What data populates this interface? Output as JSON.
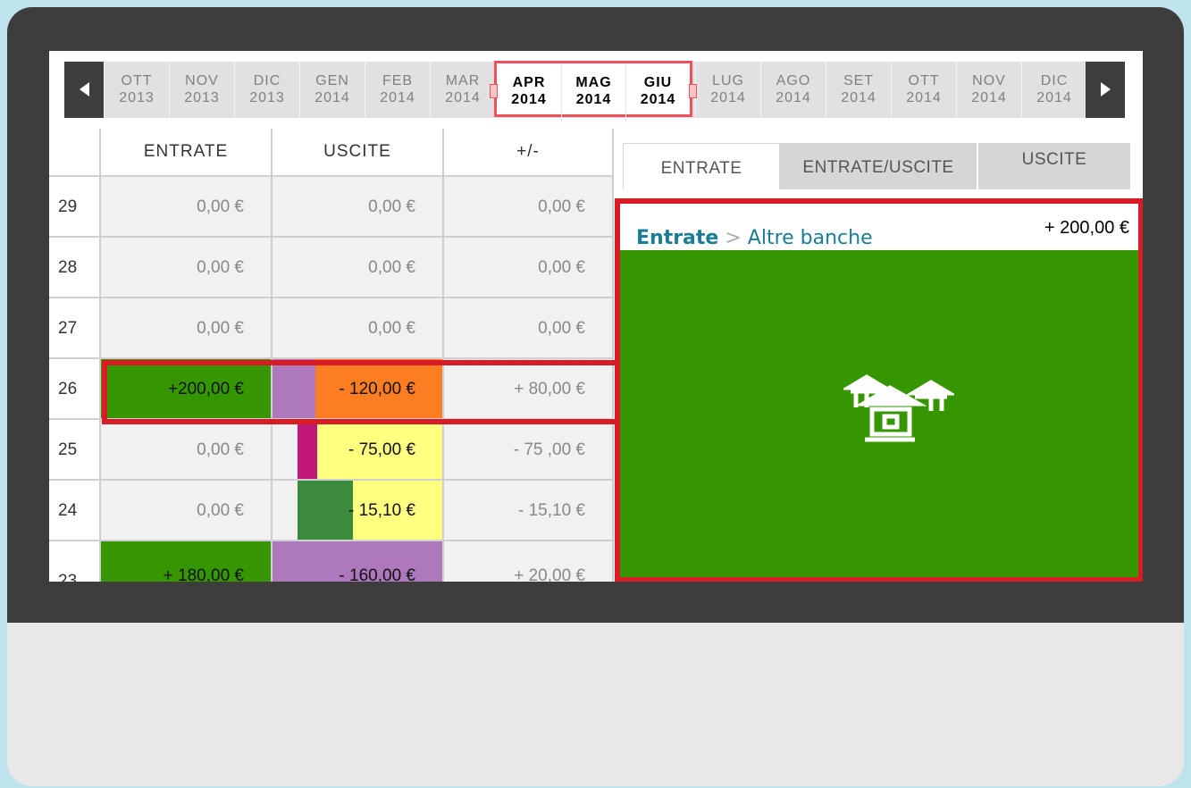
{
  "month_nav": {
    "prev_arrow": "left-arrow-icon",
    "next_arrow": "right-arrow-icon",
    "months": [
      {
        "m": "OTT",
        "y": "2013"
      },
      {
        "m": "NOV",
        "y": "2013"
      },
      {
        "m": "DIC",
        "y": "2013"
      },
      {
        "m": "GEN",
        "y": "2014"
      },
      {
        "m": "FEB",
        "y": "2014"
      },
      {
        "m": "MAR",
        "y": "2014"
      },
      {
        "m": "APR",
        "y": "2014"
      },
      {
        "m": "MAG",
        "y": "2014"
      },
      {
        "m": "GIU",
        "y": "2014"
      },
      {
        "m": "LUG",
        "y": "2014"
      },
      {
        "m": "AGO",
        "y": "2014"
      },
      {
        "m": "SET",
        "y": "2014"
      },
      {
        "m": "OTT",
        "y": "2014"
      },
      {
        "m": "NOV",
        "y": "2014"
      },
      {
        "m": "DIC",
        "y": "2014"
      }
    ],
    "selected": [
      "APR 2014",
      "MAG 2014",
      "GIU 2014"
    ]
  },
  "table": {
    "headers": [
      "ENTRATE",
      "USCITE",
      "+/-"
    ],
    "rows": [
      {
        "num": "29",
        "entrate": "0,00 €",
        "uscite": "0,00 €",
        "diff": "0,00 €"
      },
      {
        "num": "28",
        "entrate": "0,00 €",
        "uscite": "0,00 €",
        "diff": "0,00 €"
      },
      {
        "num": "27",
        "entrate": "0,00 €",
        "uscite": "0,00 €",
        "diff": "0,00 €"
      },
      {
        "num": "26",
        "entrate": "+200,00 €",
        "uscite": "- 120,00 €",
        "diff": "+ 80,00 €"
      },
      {
        "num": "25",
        "entrate": "0,00 €",
        "uscite": "- 75,00 €",
        "diff": "- 75 ,00 €"
      },
      {
        "num": "24",
        "entrate": "0,00 €",
        "uscite": "- 15,10 €",
        "diff": "- 15,10 €"
      },
      {
        "num": "23",
        "entrate": "+ 180,00 €",
        "uscite": "- 160,00 €",
        "diff": "+ 20,00 €"
      }
    ]
  },
  "panel": {
    "tabs": [
      "ENTRATE",
      "ENTRATE/USCITE",
      "USCITE"
    ],
    "active_tab": "ENTRATE",
    "breadcrumb_root": "Entrate",
    "breadcrumb_sep": ">",
    "breadcrumb_leaf": "Altre banche",
    "amount": "+ 200,00 €",
    "category_icon": "banks-icon"
  },
  "colors": {
    "green": "#359600",
    "dark_green": "#3b8a3e",
    "orange": "#fd7d23",
    "purple": "#ad78bc",
    "magenta": "#c0187a",
    "yellow": "#ffff80",
    "highlight_red": "#d81b25",
    "link_blue": "#1a7d97"
  }
}
